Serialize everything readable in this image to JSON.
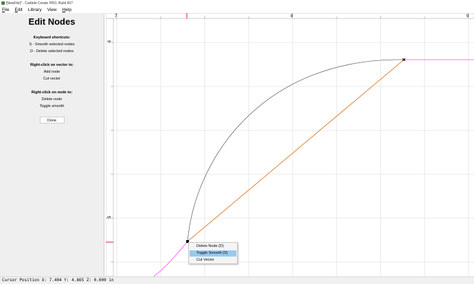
{
  "window": {
    "title": "[NewFile]* - Carbide Create PRO, Build 607"
  },
  "menubar": {
    "items": [
      {
        "ul": "F",
        "rest": "ile"
      },
      {
        "ul": "E",
        "rest": "dit"
      },
      {
        "ul": "",
        "rest": "Library"
      },
      {
        "ul": "",
        "rest": "View"
      },
      {
        "ul": "H",
        "rest": "elp"
      }
    ]
  },
  "sidebar": {
    "heading": "Edit Nodes",
    "shortcuts_title": "Keyboard shortcuts:",
    "shortcut_1": "S - Smooth selected nodes",
    "shortcut_2": "D - Delete selected nodes",
    "vector_title": "Right-click on vector to:",
    "vector_1": "Add node",
    "vector_2": "Cut vector",
    "node_title": "Right-click on node to:",
    "node_1": "Delete node",
    "node_2": "Toggle smooth",
    "done_label": "Done"
  },
  "ruler": {
    "top_labels": [
      "7",
      "8",
      "9"
    ],
    "left_labels": [
      "6",
      "5"
    ]
  },
  "context_menu": {
    "items": [
      "Delete Node (D)",
      "Toggle Smooth (S)",
      "Cut Vector"
    ],
    "highlighted": 1
  },
  "statusbar": {
    "text": "Cursor Position X: 7.404 Y: 4.865 Z: 0.000 in"
  },
  "colors": {
    "chord": "#e0853a",
    "arc": "#555555",
    "magenta": "#ff44ff",
    "ruler_marker": "#d22222",
    "grid": "#d8d8d8"
  }
}
